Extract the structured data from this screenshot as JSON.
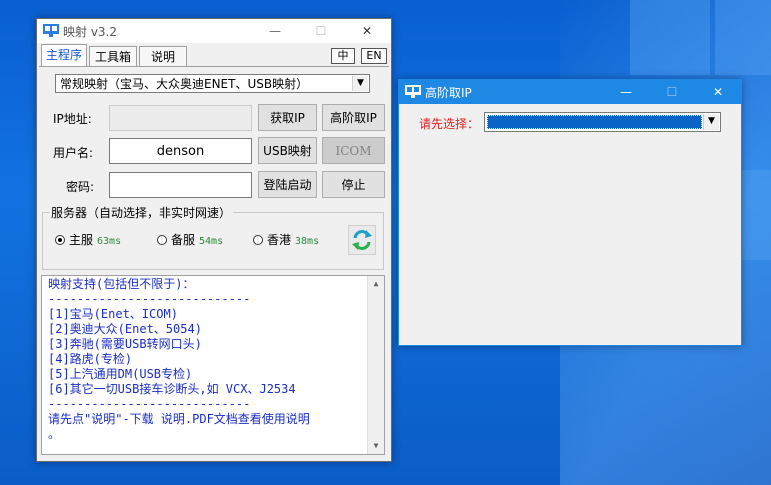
{
  "colors": {
    "desktop": "#0b5cc8",
    "active_titlebar": "#1e88e5",
    "text_blue": "#1a2ec4",
    "label_red": "#e02020",
    "ms_green": "#2a8a3a",
    "tab_selected": "#1555d6"
  },
  "main_window": {
    "title": "映射 v3.2",
    "caption": {
      "minimize": "—",
      "maximize": "☐",
      "close": "✕"
    },
    "tabs": [
      "主程序",
      "工具箱",
      "说明"
    ],
    "lang_buttons": [
      "中",
      "EN"
    ],
    "mode_select": {
      "value": "常规映射（宝马、大众奥迪ENET、USB映射）"
    },
    "ip_label": "IP地址:",
    "ip_value": "",
    "user_label": "用户名:",
    "user_value": "denson",
    "pass_label": "密码:",
    "pass_value": "",
    "buttons": {
      "get_ip": "获取IP",
      "advanced_ip": "高阶取IP",
      "usb_map": "USB映射",
      "icom": "ICOM",
      "login_start": "登陆启动",
      "stop": "停止"
    },
    "server_group": {
      "title": "服务器（自动选择，非实时网速）",
      "options": [
        {
          "label": "主服",
          "latency": "63ms",
          "selected": true
        },
        {
          "label": "备服",
          "latency": "54ms",
          "selected": false
        },
        {
          "label": "香港",
          "latency": "38ms",
          "selected": false
        }
      ],
      "refresh_icon": "refresh-icon"
    },
    "info_lines": [
      "映射支持(包括但不限于)：",
      "----------------------------",
      "[1]宝马(Enet、ICOM)",
      "[2]奥迪大众(Enet、5054)",
      "[3]奔驰(需要USB转网口头)",
      "[4]路虎(专检)",
      "[5]上汽通用DM(USB专检)",
      "[6]其它一切USB接车诊断头,如 VCX、J2534",
      "----------------------------",
      "请先点\"说明\"-下载 说明.PDF文档查看使用说明",
      "。"
    ]
  },
  "adv_window": {
    "title": "高阶取IP",
    "caption": {
      "minimize": "—",
      "maximize": "☐",
      "close": "✕"
    },
    "select_label": "请先选择：",
    "select_value": ""
  }
}
